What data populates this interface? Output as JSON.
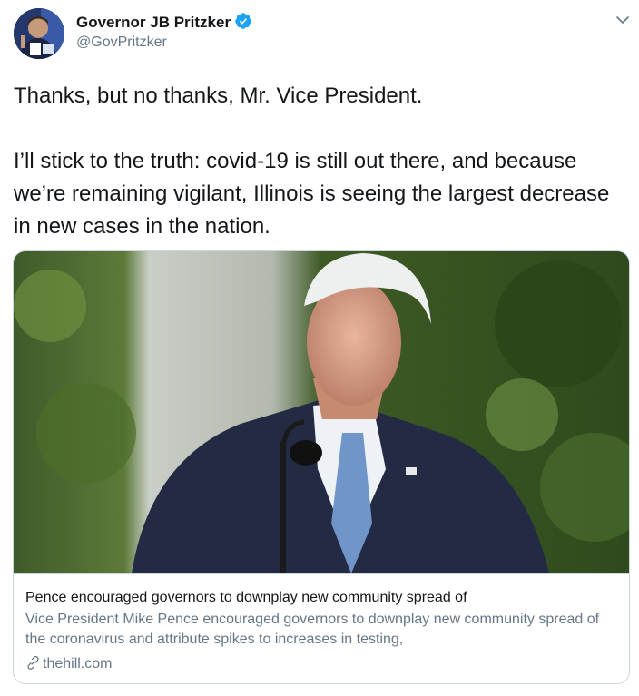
{
  "author": {
    "display_name": "Governor JB Pritzker",
    "handle": "@GovPritzker",
    "verified_icon": "verified-badge-icon",
    "avatar_icon": "avatar"
  },
  "tweet": {
    "paragraphs": [
      "Thanks, but no thanks, Mr. Vice President.",
      "I’ll stick to the truth: covid-19 is still out there, and because we’re remaining vigilant, Illinois is seeing the largest decrease in new cases in the nation."
    ]
  },
  "card": {
    "title": "Pence encouraged governors to downplay new community spread of",
    "description": "Vice President Mike Pence encouraged governors to downplay new community spread of the coronavirus and attribute spikes to increases in testing,",
    "domain": "thehill.com",
    "link_icon": "link-icon"
  },
  "colors": {
    "text": "#14171a",
    "secondary": "#657786",
    "verified_blue": "#1da1f2",
    "border": "#ccd6dd"
  }
}
